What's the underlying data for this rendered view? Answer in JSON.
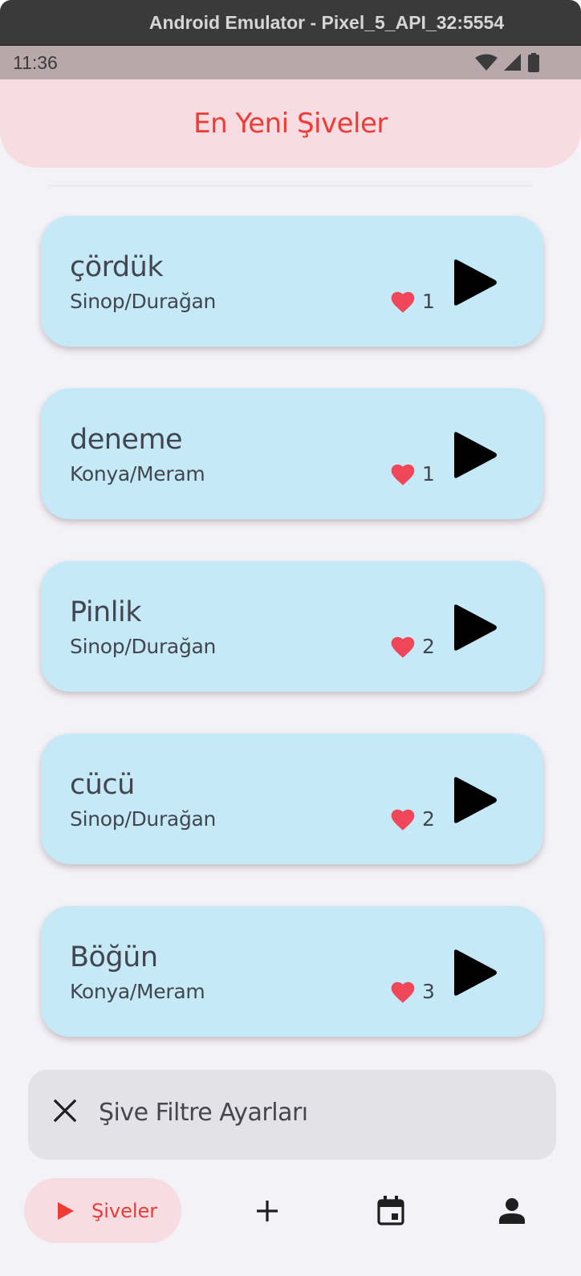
{
  "window": {
    "title": "Android Emulator - Pixel_5_API_32:5554"
  },
  "status_bar": {
    "time": "11:36",
    "icons": [
      "wifi-icon",
      "cellular-signal-icon",
      "battery-icon"
    ]
  },
  "app_bar": {
    "title": "En Yeni Şiveler"
  },
  "items": [
    {
      "word": "çördük",
      "location": "Sinop/Durağan",
      "likes": "1"
    },
    {
      "word": "deneme",
      "location": "Konya/Meram",
      "likes": "1"
    },
    {
      "word": "Pinlik",
      "location": "Sinop/Durağan",
      "likes": "2"
    },
    {
      "word": "cücü",
      "location": "Sinop/Durağan",
      "likes": "2"
    },
    {
      "word": "Böğün",
      "location": "Konya/Meram",
      "likes": "3"
    }
  ],
  "filter_panel": {
    "label": "Şive Filtre Ayarları",
    "icon": "close-icon"
  },
  "bottom_nav": {
    "items": [
      {
        "label": "Şiveler",
        "icon": "play-icon",
        "active": true
      },
      {
        "label": "",
        "icon": "add-icon",
        "active": false
      },
      {
        "label": "",
        "icon": "calendar-icon",
        "active": false
      },
      {
        "label": "",
        "icon": "person-icon",
        "active": false
      }
    ]
  },
  "colors": {
    "accent": "#ee3b36",
    "app_bar_bg": "#f7dce2",
    "card_bg": "#c5e9f6",
    "heart": "#f0465a",
    "background": "#f3f2f7"
  }
}
